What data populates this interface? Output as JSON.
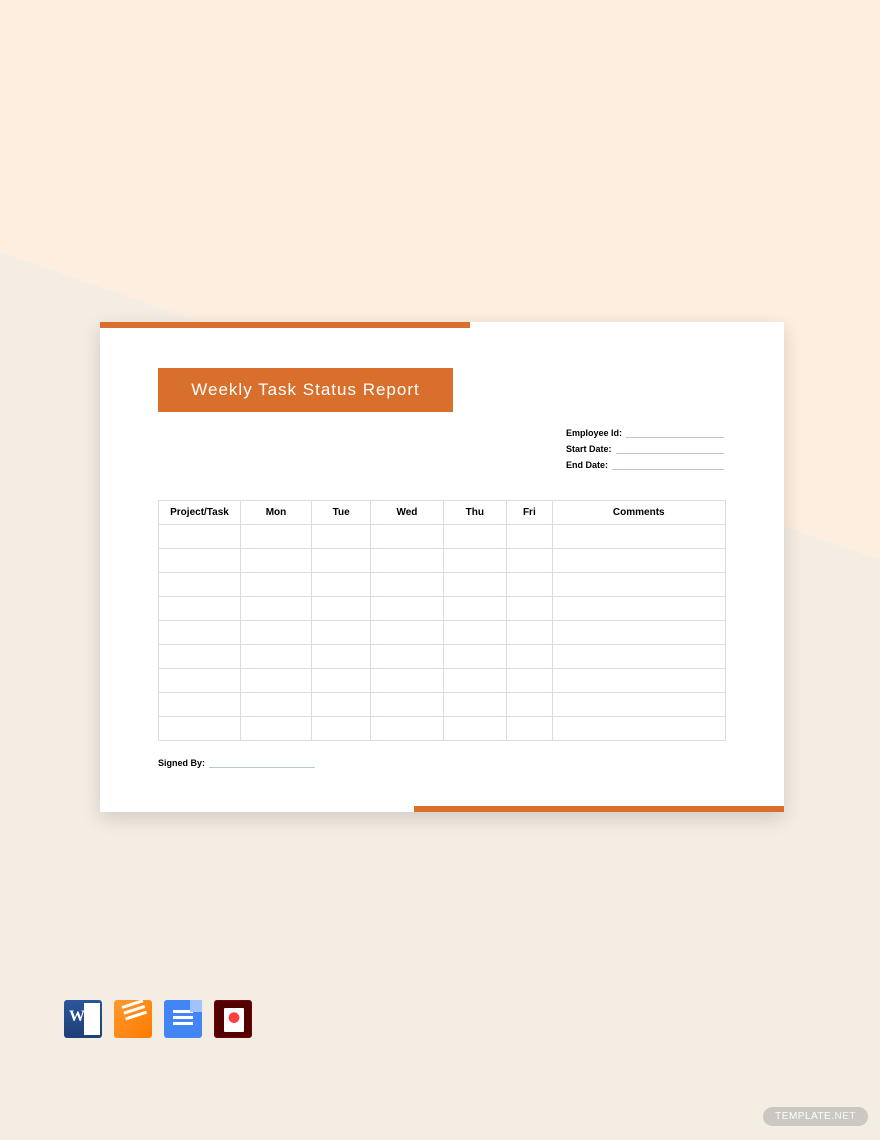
{
  "document": {
    "title": "Weekly Task Status Report",
    "meta": {
      "employee_id_label": "Employee Id:",
      "start_date_label": "Start Date:",
      "end_date_label": "End Date:"
    },
    "table": {
      "headers": [
        "Project/Task",
        "Mon",
        "Tue",
        "Wed",
        "Thu",
        "Fri",
        "Comments"
      ],
      "row_count": 9
    },
    "signed_by_label": "Signed By:"
  },
  "icons": {
    "word": "word-icon",
    "pages": "pages-icon",
    "gdoc": "google-docs-icon",
    "pdf": "pdf-icon"
  },
  "watermark": {
    "brand": "TEMPLATE",
    "suffix": ".NET"
  }
}
